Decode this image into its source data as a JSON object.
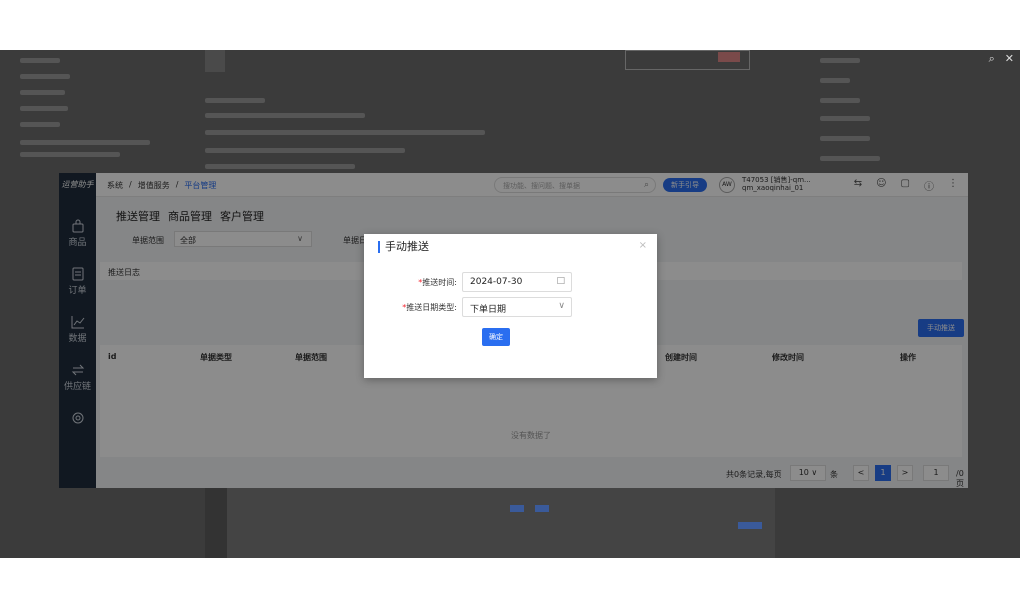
{
  "viewer": {
    "zoom_icon": "magnifier-icon",
    "close_icon": "close-icon"
  },
  "app": {
    "logo": "运营助手",
    "sidebar": [
      {
        "label": "商品",
        "icon": "bag-icon"
      },
      {
        "label": "订单",
        "icon": "document-icon"
      },
      {
        "label": "数据",
        "icon": "chart-icon"
      },
      {
        "label": "供应链",
        "icon": "swap-icon"
      },
      {
        "label": "",
        "icon": "settings-icon"
      }
    ],
    "breadcrumb": [
      "系统",
      "增值服务",
      "平台管理"
    ],
    "search_placeholder": "搜功能、搜问题、搜单据",
    "new_button": "新手引导",
    "user_avatar": "AW",
    "user_line1": "T47053 [销售]-qm...",
    "user_line2": "qm_xaoqinhai_01",
    "tabs": [
      "推送管理",
      "商品管理",
      "客户管理"
    ],
    "filter": {
      "label": "单据范围",
      "value": "全部",
      "label2": "单据日"
    },
    "card_title": "推送日志",
    "push_button": "手动推送",
    "columns": [
      "id",
      "单据类型",
      "单据范围",
      "创建时间",
      "修改时间",
      "操作"
    ],
    "empty_text": "没有数据了",
    "pager": {
      "info": "共0条记录,每页",
      "size": "10",
      "unit": "条",
      "prev": "<",
      "page": "1",
      "next": ">",
      "jump": "1",
      "total": "/0页"
    }
  },
  "modal": {
    "title": "手动推送",
    "close": "×",
    "push_time_label": "推送时间:",
    "push_time_value": "2024-07-30",
    "date_type_label": "推送日期类型:",
    "date_type_value": "下单日期",
    "ok_button": "确定"
  },
  "colors": {
    "accent": "#2a6ef0",
    "sidebar": "#1f2d3d",
    "required": "#f5222d"
  }
}
